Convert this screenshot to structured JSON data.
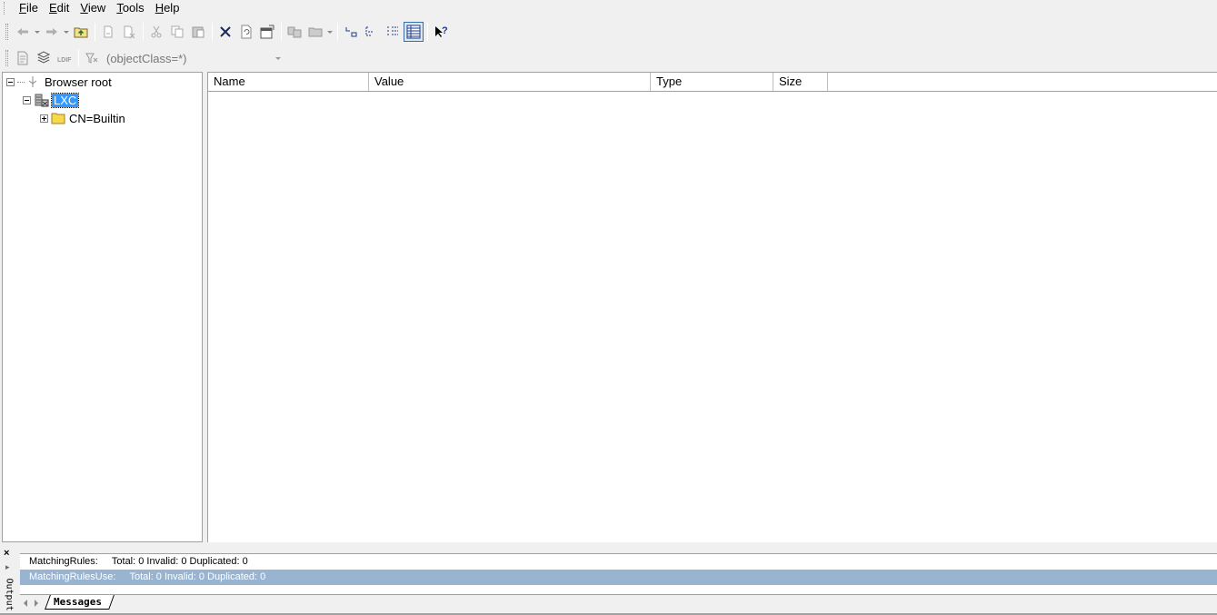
{
  "menu": {
    "items": [
      {
        "accel": "F",
        "rest": "ile"
      },
      {
        "accel": "E",
        "rest": "dit"
      },
      {
        "accel": "V",
        "rest": "iew"
      },
      {
        "accel": "T",
        "rest": "ools"
      },
      {
        "accel": "H",
        "rest": "elp"
      }
    ]
  },
  "filter": {
    "value": "(objectClass=*)"
  },
  "tree": {
    "root_label": "Browser root",
    "server_label": "LXC",
    "child_label": "CN=Builtin"
  },
  "details": {
    "columns": [
      "Name",
      "Value",
      "Type",
      "Size"
    ]
  },
  "output": {
    "label": "Output",
    "close_glyph": "×",
    "messages": [
      "MatchingRules:     Total: 0 Invalid: 0 Duplicated: 0",
      "MatchingRulesUse:     Total: 0 Invalid: 0 Duplicated: 0"
    ],
    "tab_label": "Messages"
  },
  "colors": {
    "selection": "#3399ff",
    "message_highlight": "#99b4d1"
  }
}
